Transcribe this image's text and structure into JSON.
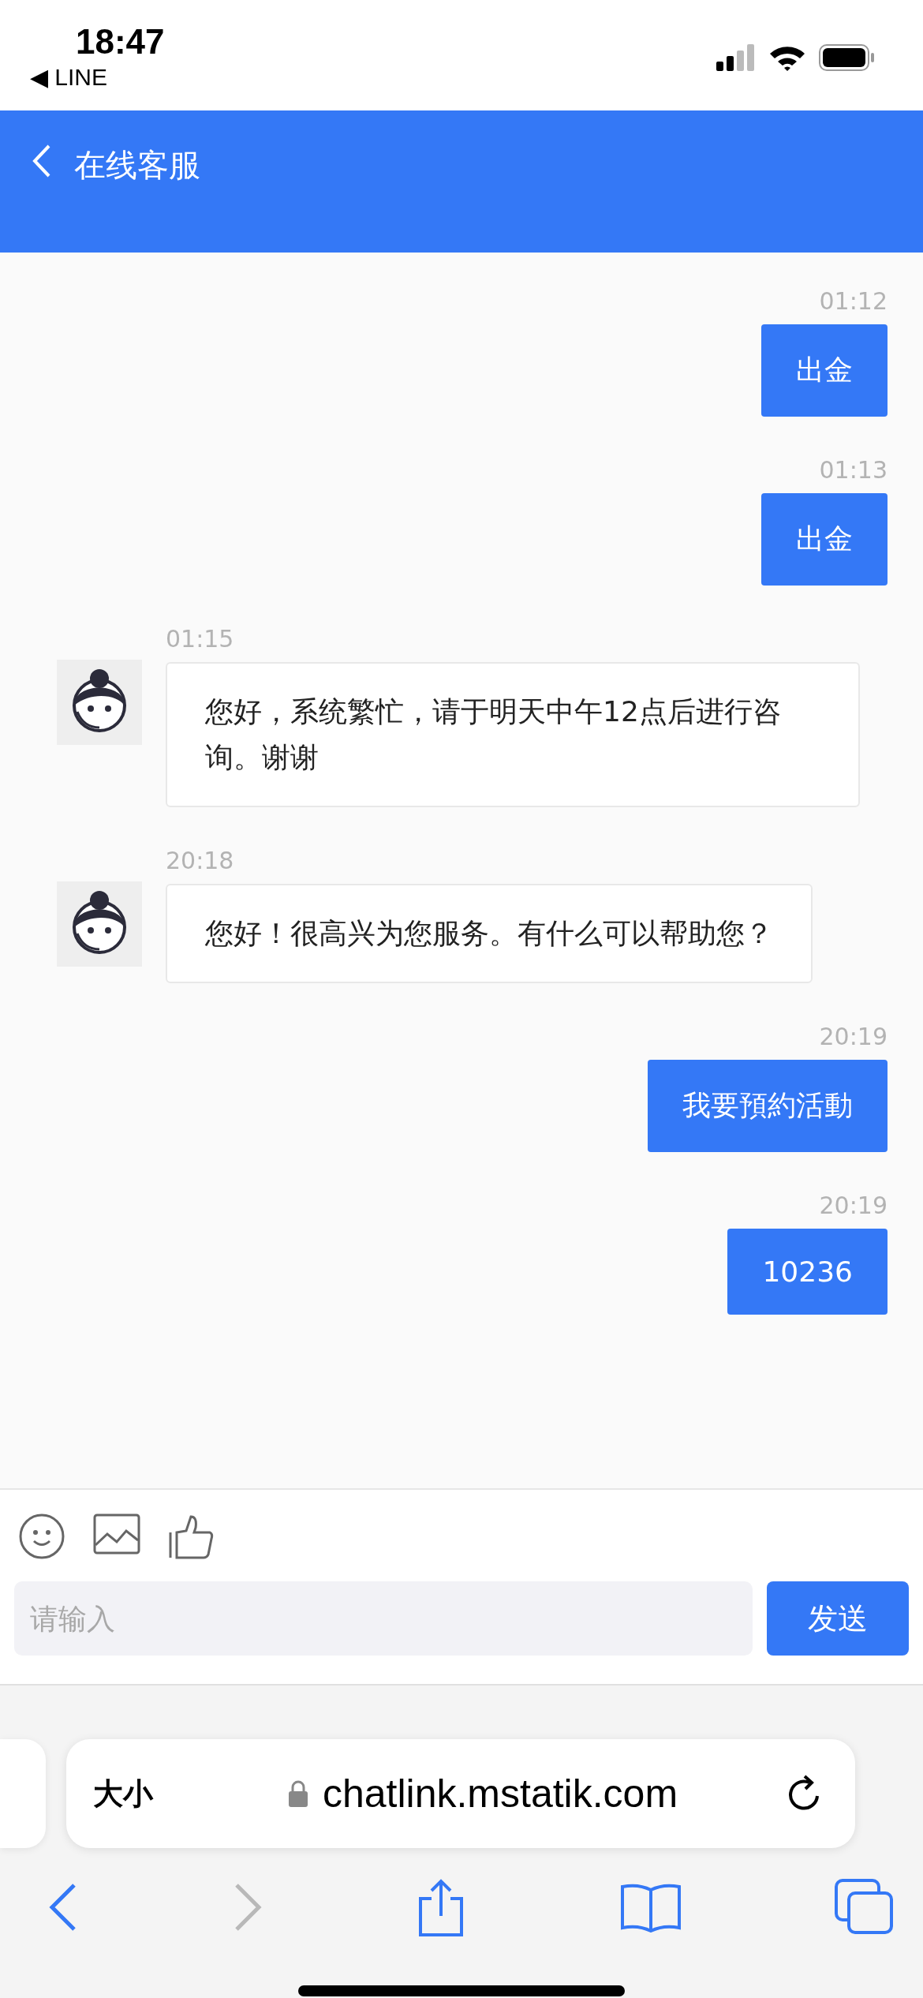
{
  "status_bar": {
    "time": "18:47",
    "back_app": "◀ LINE"
  },
  "header": {
    "title": "在线客服"
  },
  "messages": [
    {
      "kind": "user",
      "time": "01:12",
      "text": "出金"
    },
    {
      "kind": "user",
      "time": "01:13",
      "text": "出金"
    },
    {
      "kind": "agent",
      "time": "01:15",
      "text": "您好，系统繁忙，请于明天中午12点后进行咨询。谢谢"
    },
    {
      "kind": "agent",
      "time": "20:18",
      "text": "您好！很高兴为您服务。有什么可以帮助您？"
    },
    {
      "kind": "user",
      "time": "20:19",
      "text": "我要預約活動"
    },
    {
      "kind": "user",
      "time": "20:19",
      "text": "10236"
    }
  ],
  "composer": {
    "placeholder": "请输入",
    "send": "发送"
  },
  "browser": {
    "text_size": "大小",
    "url": "chatlink.mstatik.com",
    "back_disabled": false,
    "forward_disabled": true
  }
}
